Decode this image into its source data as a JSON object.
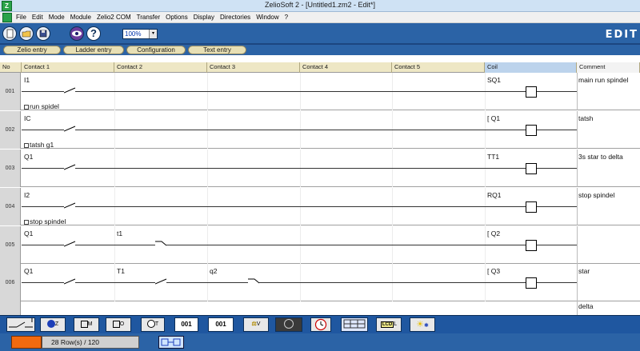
{
  "window": {
    "title": "ZelioSoft 2 - [Untitled1.zm2 - Edit*]"
  },
  "menu": [
    "File",
    "Edit",
    "Mode",
    "Module",
    "Zelio2 COM",
    "Transfer",
    "Options",
    "Display",
    "Directories",
    "Window",
    "?"
  ],
  "toolbar": {
    "zoom": "100%",
    "zoom_arrow": "▾",
    "brand": "EDIT",
    "help": "?"
  },
  "modes": {
    "zelio": "Zelio entry",
    "ladder": "Ladder entry",
    "config": "Configuration",
    "text": "Text entry"
  },
  "headers": {
    "no": "No",
    "c1": "Contact 1",
    "c2": "Contact 2",
    "c3": "Contact 3",
    "c4": "Contact 4",
    "c5": "Contact 5",
    "coil": "Coil",
    "comment": "Comment"
  },
  "rows": [
    {
      "num": "001",
      "c1": "I1",
      "c1_note": "run spidel",
      "c2": "",
      "c3": "",
      "coil": "SQ1",
      "comment": "main run spindel"
    },
    {
      "num": "002",
      "c1": "IC",
      "c1_note": "tatsh g1",
      "c2": "",
      "c3": "",
      "coil": "[ Q1",
      "comment": "tatsh"
    },
    {
      "num": "003",
      "c1": "Q1",
      "c1_note": "",
      "c2": "",
      "c3": "",
      "coil": "TT1",
      "comment": "3s star to delta"
    },
    {
      "num": "004",
      "c1": "I2",
      "c1_note": "stop spindel",
      "c2": "",
      "c3": "",
      "coil": "RQ1",
      "comment": "stop spindel"
    },
    {
      "num": "005",
      "c1": "Q1",
      "c1_note": "",
      "c2": "t1",
      "c3": "",
      "coil": "[ Q2",
      "comment": ""
    },
    {
      "num": "006",
      "c1": "Q1",
      "c1_note": "",
      "c2": "T1",
      "c3": "q2",
      "coil": "[ Q3",
      "comment": "star"
    },
    {
      "num": "",
      "c1": "",
      "c1_note": "",
      "c2": "",
      "c3": "",
      "coil": "",
      "comment": "delta"
    }
  ],
  "palette": {
    "z": "Z",
    "m": "M",
    "o": "O",
    "t": "T",
    "v": "V",
    "l": "L",
    "lcd": "LCD",
    "i": "I"
  },
  "status": {
    "rows": "28 Row(s) / 120"
  },
  "colors": {
    "toolbar": "#2b63a6",
    "header": "#eee7c5",
    "coil_header": "#bcd3ec",
    "status_orange": "#f26a10"
  }
}
